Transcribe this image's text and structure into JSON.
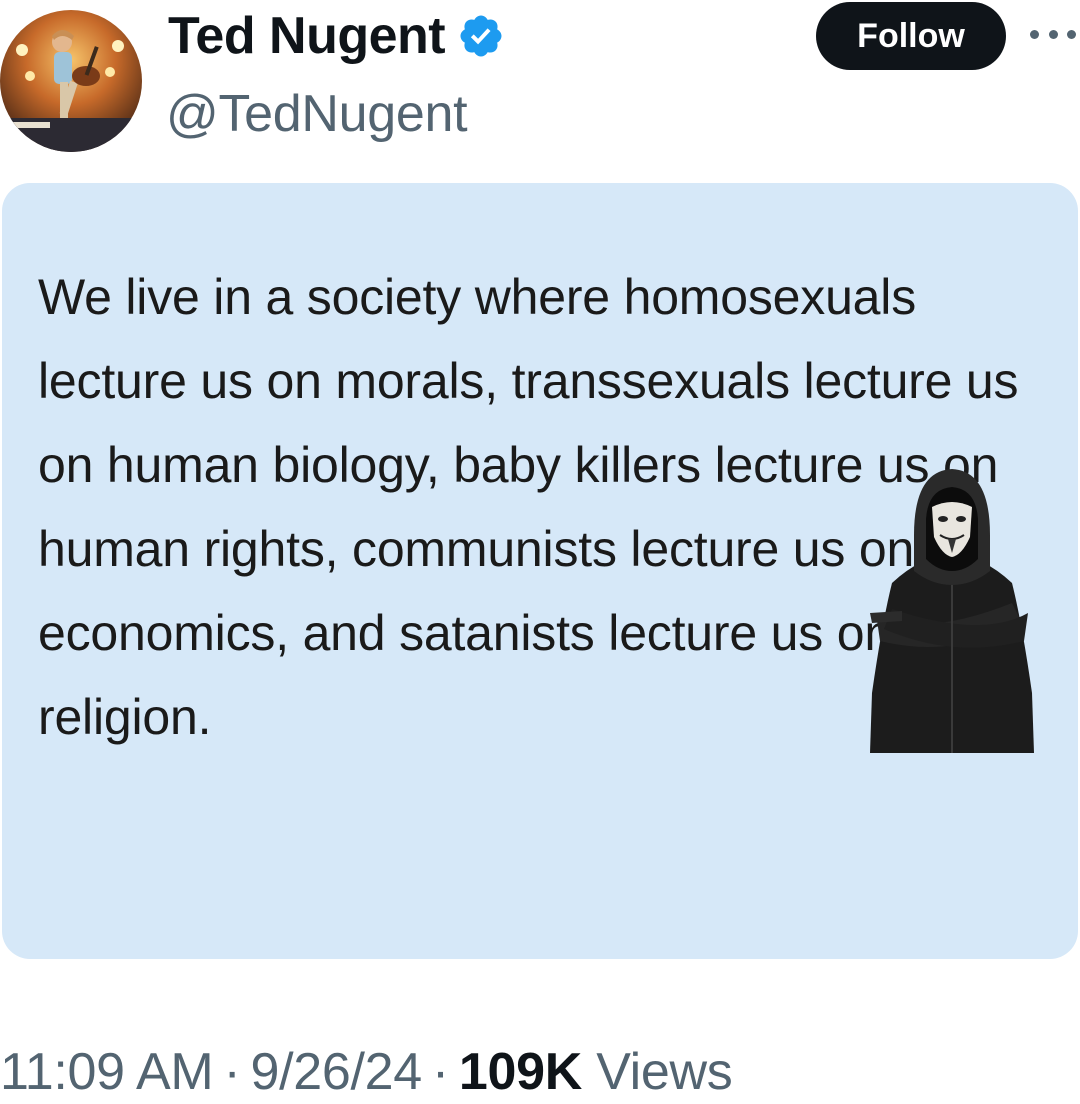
{
  "author": {
    "display_name": "Ted Nugent",
    "handle": "@TedNugent",
    "verified": true
  },
  "header": {
    "follow_label": "Follow"
  },
  "media": {
    "text": "We live in a society where homosexuals lecture us on morals, transsexuals lecture us on human biology, baby killers lecture us on human rights, communists lecture us on economics, and satanists lecture us on religion.",
    "background_color": "#d6e8f8"
  },
  "meta": {
    "time": "11:09 AM",
    "separator": "·",
    "date": "9/26/24",
    "views_count": "109K",
    "views_label": "Views"
  },
  "icons": {
    "verified": "verified-badge-icon",
    "more": "more-options-icon"
  },
  "colors": {
    "verified_blue": "#1d9bf0",
    "text_primary": "#0f1419",
    "text_secondary": "#536471",
    "follow_bg": "#0f1419"
  }
}
